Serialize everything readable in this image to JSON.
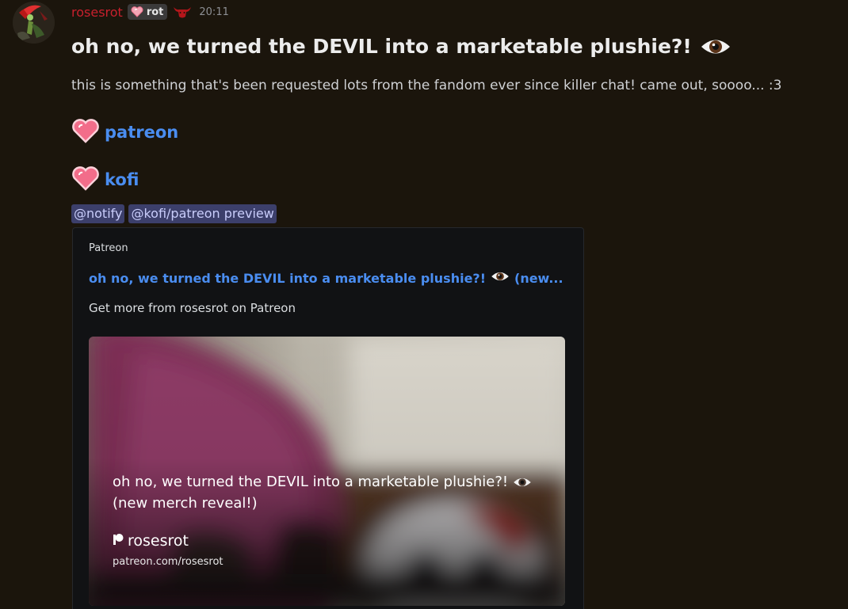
{
  "message": {
    "username": "rosesrot",
    "role_tag": "rot",
    "timestamp": "20:11",
    "title": "oh no, we turned the DEVIL into a marketable plushie?!",
    "body": "this is something that's been requested lots from the fandom ever since killer chat! came out, soooo... :3",
    "links": [
      {
        "label": "patreon",
        "icon": "heart-icon"
      },
      {
        "label": "kofi",
        "icon": "heart-icon"
      }
    ],
    "mentions": [
      "@notify",
      "@kofi/patreon preview"
    ]
  },
  "embed": {
    "provider": "Patreon",
    "title": "oh no, we turned the DEVIL into a marketable plushie?!",
    "title_suffix": "(new...",
    "description": "Get more from rosesrot on Patreon",
    "image": {
      "title_line1": "oh no, we turned the DEVIL into a marketable plushie?!",
      "title_line2": "(new merch reveal!)",
      "author": "rosesrot",
      "url": "patreon.com/rosesrot"
    }
  },
  "colors": {
    "background": "#1b150c",
    "username": "#c8202d",
    "link": "#4a8df0",
    "mention_bg": "#3c3f6b",
    "embed_bg": "#111214"
  }
}
